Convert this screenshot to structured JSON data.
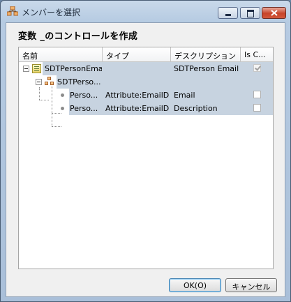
{
  "window": {
    "title": "メンバーを選択"
  },
  "heading": "変数 _のコントロールを作成",
  "columns": [
    "名前",
    "タイプ",
    "デスクリプション",
    "Is C..."
  ],
  "rows": [
    {
      "name": "SDTPersonEmail",
      "type": "",
      "description": "SDTPerson Email",
      "checked": true
    },
    {
      "name": "SDTPerso...",
      "type": "",
      "description": "",
      "checked": null
    },
    {
      "name": "Perso...",
      "type": "Attribute:EmailDir",
      "description": "Email",
      "checked": false
    },
    {
      "name": "Perso...",
      "type": "Attribute:EmailD...",
      "description": "Description",
      "checked": false
    }
  ],
  "buttons": {
    "ok": "OK(O)",
    "cancel": "キャンセル"
  },
  "icons": {
    "app": "hierarchy-icon",
    "root": "sdt-icon",
    "level": "level-icon",
    "leaf": "attribute-dot-icon"
  }
}
